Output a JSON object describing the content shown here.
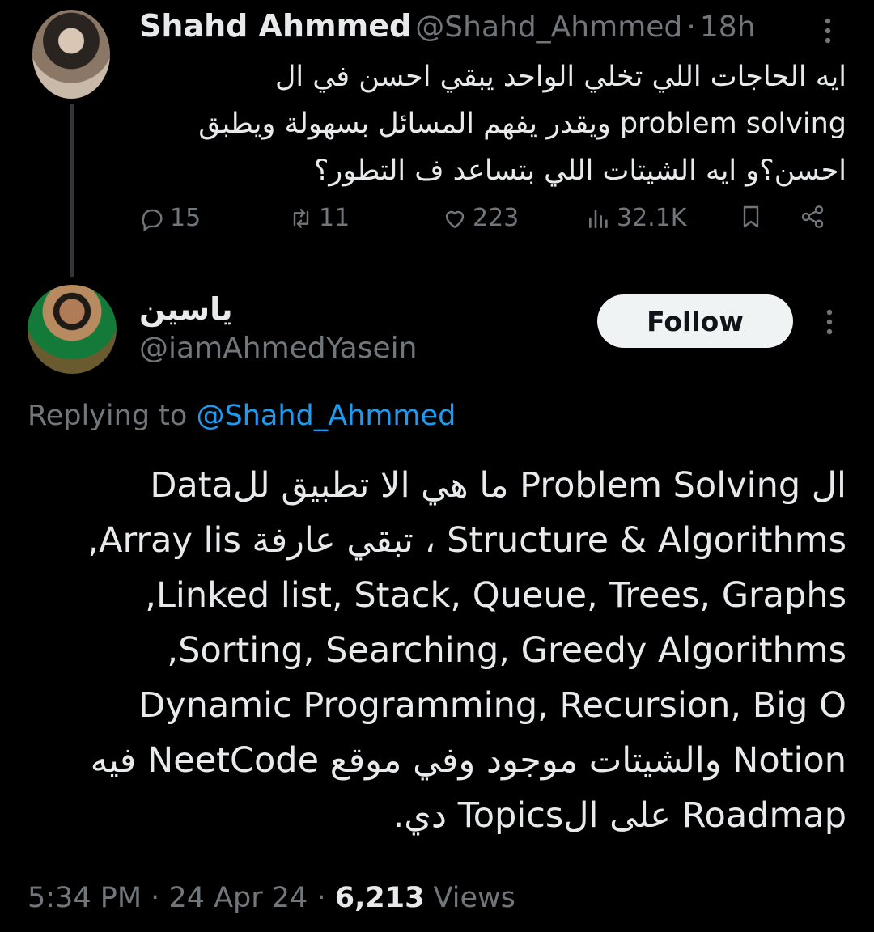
{
  "parent_tweet": {
    "author_name": "Shahd Ahmmed",
    "author_handle": "@Shahd_Ahmmed",
    "separator": "·",
    "time_ago": "18h",
    "text_lines": [
      "ايه الحاجات  اللي تخلي الواحد يبقي احسن في ال",
      "problem solving ويقدر يفهم المسائل بسهولة ويطبق",
      "احسن؟و ايه الشيتات اللي بتساعد ف التطور؟"
    ],
    "actions": {
      "replies": "15",
      "retweets": "11",
      "likes": "223",
      "views": "32.1K"
    }
  },
  "reply_tweet": {
    "author_name": "ياسين",
    "author_handle": "@iamAhmedYasein",
    "follow_label": "Follow",
    "replying_prefix": "Replying to",
    "replying_mention": "@Shahd_Ahmmed",
    "text_lines": [
      "ال Problem Solving ما هي الا تطبيق للData",
      "Structure & Algorithms ، تبقي عارفة Array lis,",
      "Linked list, Stack, Queue, Trees, Graphs,",
      "Sorting, Searching, Greedy Algorithms,",
      "Dynamic Programming, Recursion, Big O",
      "Notion والشيتات موجود وفي موقع NeetCode فيه",
      "Roadmap على الTopics دي."
    ],
    "time": "5:34 PM",
    "date": "24 Apr 24",
    "separator": "·",
    "views_count": "6,213",
    "views_label": "Views"
  },
  "colors": {
    "background": "#000000",
    "text": "#e7e9ea",
    "muted": "#71767b",
    "link": "#1d9bf0",
    "follow_bg": "#eff3f4"
  }
}
